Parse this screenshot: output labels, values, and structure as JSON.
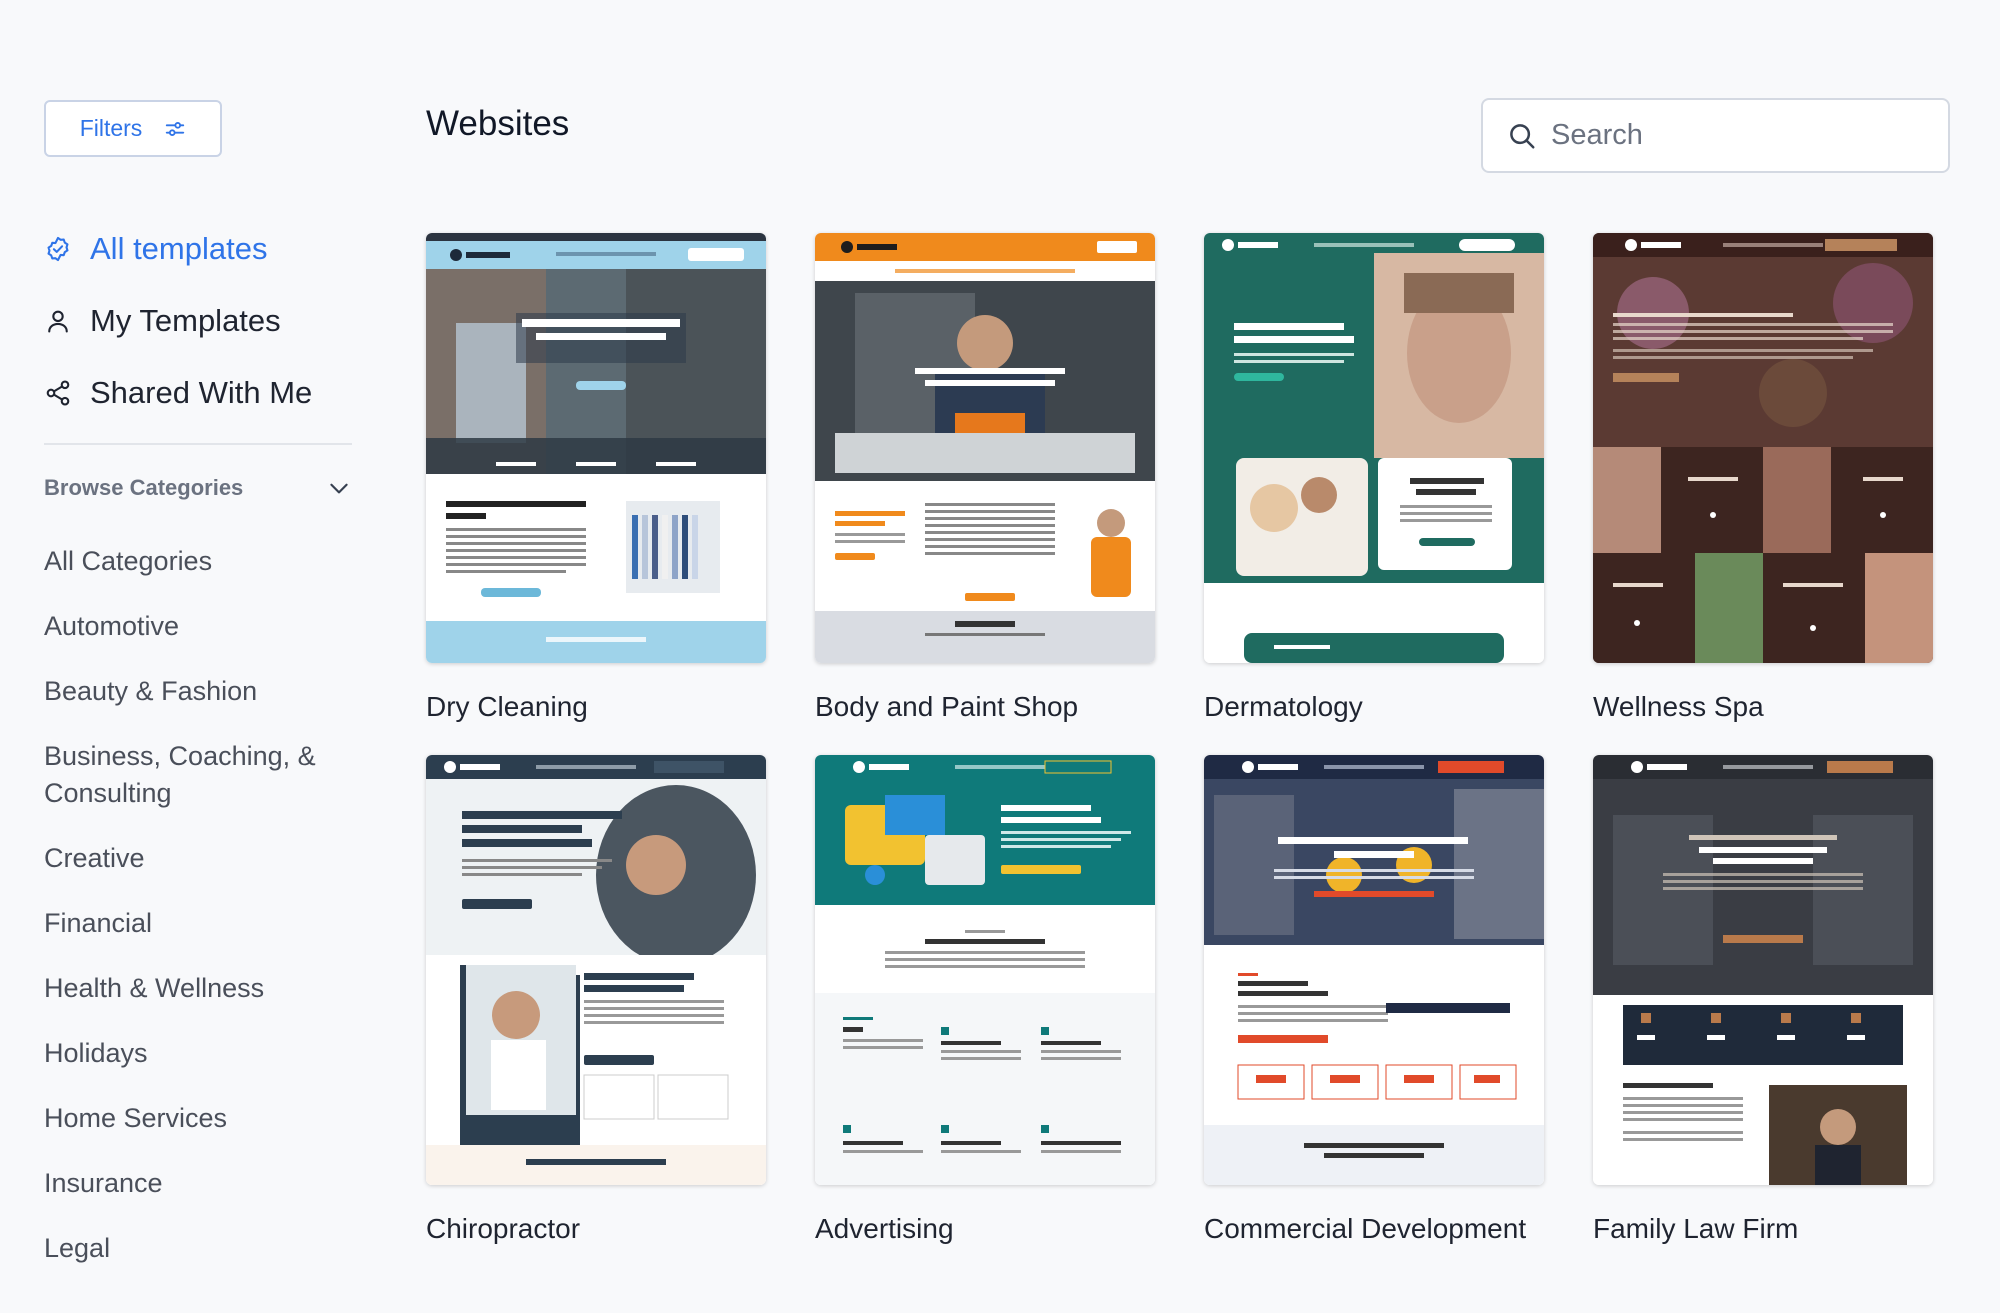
{
  "sidebar": {
    "filters_label": "Filters",
    "nav": [
      {
        "label": "All templates",
        "icon": "check-circle-icon",
        "active": true
      },
      {
        "label": "My Templates",
        "icon": "user-icon",
        "active": false
      },
      {
        "label": "Shared With Me",
        "icon": "share-icon",
        "active": false
      }
    ],
    "browse_label": "Browse Categories",
    "categories": [
      "All Categories",
      "Automotive",
      "Beauty & Fashion",
      "Business, Coaching, & Consulting",
      "Creative",
      "Financial",
      "Health & Wellness",
      "Holidays",
      "Home Services",
      "Insurance",
      "Legal"
    ]
  },
  "main": {
    "title": "Websites",
    "search_placeholder": "Search",
    "templates": [
      {
        "name": "Dry Cleaning"
      },
      {
        "name": "Body and Paint Shop"
      },
      {
        "name": "Dermatology"
      },
      {
        "name": "Wellness Spa"
      },
      {
        "name": "Chiropractor"
      },
      {
        "name": "Advertising"
      },
      {
        "name": "Commercial Development"
      },
      {
        "name": "Family Law Firm"
      }
    ]
  },
  "colors": {
    "accent": "#2f74e8",
    "background": "#f8f9fb"
  }
}
